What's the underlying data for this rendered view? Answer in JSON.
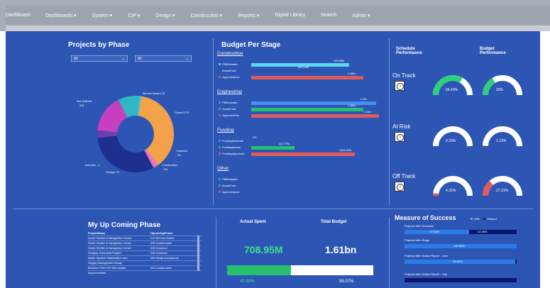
{
  "nav": {
    "items": [
      "Dashboard",
      "Dashboards",
      "System",
      "CIP",
      "Design",
      "Construction",
      "Reports",
      "Digital Library",
      "Search",
      "Admin"
    ],
    "dropdowns": [
      false,
      true,
      true,
      true,
      true,
      true,
      true,
      false,
      false,
      true
    ]
  },
  "phase": {
    "title": "Projects by Phase",
    "filter1": "All",
    "filter2": "All",
    "labels": {
      "not_defined": "Not Defined",
      "not_defined_value": "331",
      "bid_award": "Bid and Award 12",
      "closed": "Closed 275",
      "closeout": "Closeout",
      "closeout_value": "28",
      "construction": "Construction",
      "construction_value": "141",
      "design": "Design 76",
      "includes": "Includes...1"
    },
    "slices": [
      {
        "name": "Not Defined",
        "value": 331,
        "color": "#f4a24a"
      },
      {
        "name": "Bid and Award",
        "value": 12,
        "color": "#e080c8"
      },
      {
        "name": "Bid",
        "value": 8,
        "color": "#f06aa8"
      },
      {
        "name": "Closed",
        "value": 275,
        "color": "#1d2f8f"
      },
      {
        "name": "Closeout",
        "value": 28,
        "color": "#6b3fb0"
      },
      {
        "name": "Construction",
        "value": 141,
        "color": "#c640c0"
      },
      {
        "name": "Design",
        "value": 76,
        "color": "#2fb7c4"
      },
      {
        "name": "Includes",
        "value": 10,
        "color": "#40c0e0"
      }
    ]
  },
  "budget": {
    "title": "Budget Per Stage",
    "groups": [
      {
        "name": "Construction",
        "bars": [
          {
            "label": "PMEstimate",
            "value": 945.85,
            "text": "945.85M",
            "color": "#5ad8f0"
          },
          {
            "label": "ActualCost",
            "value": 602.0,
            "text": "602.00M",
            "color": "#2e4fa8"
          },
          {
            "label": "Approvedcost",
            "value": 1080,
            "text": "1.08bn",
            "color": "#e05a5a"
          }
        ]
      },
      {
        "name": "Engineering",
        "bars": [
          {
            "label": "PMEstimate",
            "value": 1200,
            "text": "1.2bn",
            "color": "#4a8ef0"
          },
          {
            "label": "ActualCost",
            "value": 1080,
            "text": "1.08bn",
            "color": "#26c070"
          },
          {
            "label": "ApprovedFee",
            "value": 1230,
            "text": "1.23bn",
            "color": "#e05a5a"
          }
        ]
      },
      {
        "name": "Funding",
        "bars": [
          {
            "label": "FundingEstimate",
            "value": 0,
            "text": "0%",
            "color": "#4a8ef0"
          },
          {
            "label": "FundingActual",
            "value": 417.77,
            "text": "417.77M",
            "color": "#26c070"
          },
          {
            "label": "FundingApproved",
            "value": 1000,
            "text": "1000.00M",
            "color": "#e05a5a"
          }
        ]
      },
      {
        "name": "Other",
        "bars": [
          {
            "label": "PMEstimate",
            "value": 0,
            "text": "",
            "color": "#4a8ef0"
          },
          {
            "label": "ActualCost",
            "value": 0,
            "text": "",
            "color": "#26c070"
          },
          {
            "label": "Approvedcost",
            "value": 0,
            "text": "",
            "color": "#e05a5a"
          }
        ]
      }
    ]
  },
  "performance": {
    "schedule_header": "Schedule Performance",
    "budget_header": "Budget Performance",
    "rows": [
      {
        "status": "On Track",
        "schedule": 66.42,
        "schedule_text": "66.42%",
        "budget": 33,
        "budget_text": "33%",
        "color": "#2fd07a"
      },
      {
        "status": "At Risk",
        "schedule": 0.33,
        "schedule_text": "0.33%",
        "budget": 1.23,
        "budget_text": "1.23%",
        "color": "#f0c040"
      },
      {
        "status": "Off Track",
        "schedule": 4.31,
        "schedule_text": "4.31%",
        "budget": 27.31,
        "budget_text": "27.31%",
        "color": "#e05a5a"
      }
    ]
  },
  "upcoming": {
    "title": "My Up Coming Phase",
    "col1": "ProjectName",
    "col2": "UpcomingPhase",
    "rows": [
      [
        "South Shelter & Navigation Center",
        "010 Bid and Award"
      ],
      [
        "South Shelter & Navigation Center",
        "030 Construction"
      ],
      [
        "South Shelter & Navigation Center",
        "020 Closeout"
      ],
      [
        "Shopley Greenbelt Project",
        "030 Closeout"
      ],
      [
        "Water System Stabilization and",
        "050 Study Acceptance"
      ],
      [
        "Supply Management Study",
        ""
      ],
      [
        "Madison Park CIP Stormwater",
        "020 Construction"
      ],
      [
        "Improvements",
        ""
      ]
    ]
  },
  "spend": {
    "actual_label": "Actual Spent",
    "total_label": "Total Budget",
    "actual_value": "708.95M",
    "total_value": "1.61bn",
    "progress": 0.4393,
    "progress_text": "43.93%",
    "remaining_text": "56.07%"
  },
  "success": {
    "title": "Measure of Success",
    "legend_with": "With",
    "legend_without": "Without",
    "rows": [
      {
        "label": "Projects With Schedule",
        "with": 57.62,
        "with_text": "57.62%",
        "without_text": "42.38%"
      },
      {
        "label": "Projects With Stage",
        "with": 100,
        "with_text": "100.00%",
        "without_text": ""
      },
      {
        "label": "Projects With Status Report - June",
        "with": 99.0,
        "with_text": "99.00%",
        "without_text": ""
      },
      {
        "label": "Projects With Status Report - July",
        "with": 0,
        "with_text": "",
        "without_text": ""
      }
    ]
  }
}
